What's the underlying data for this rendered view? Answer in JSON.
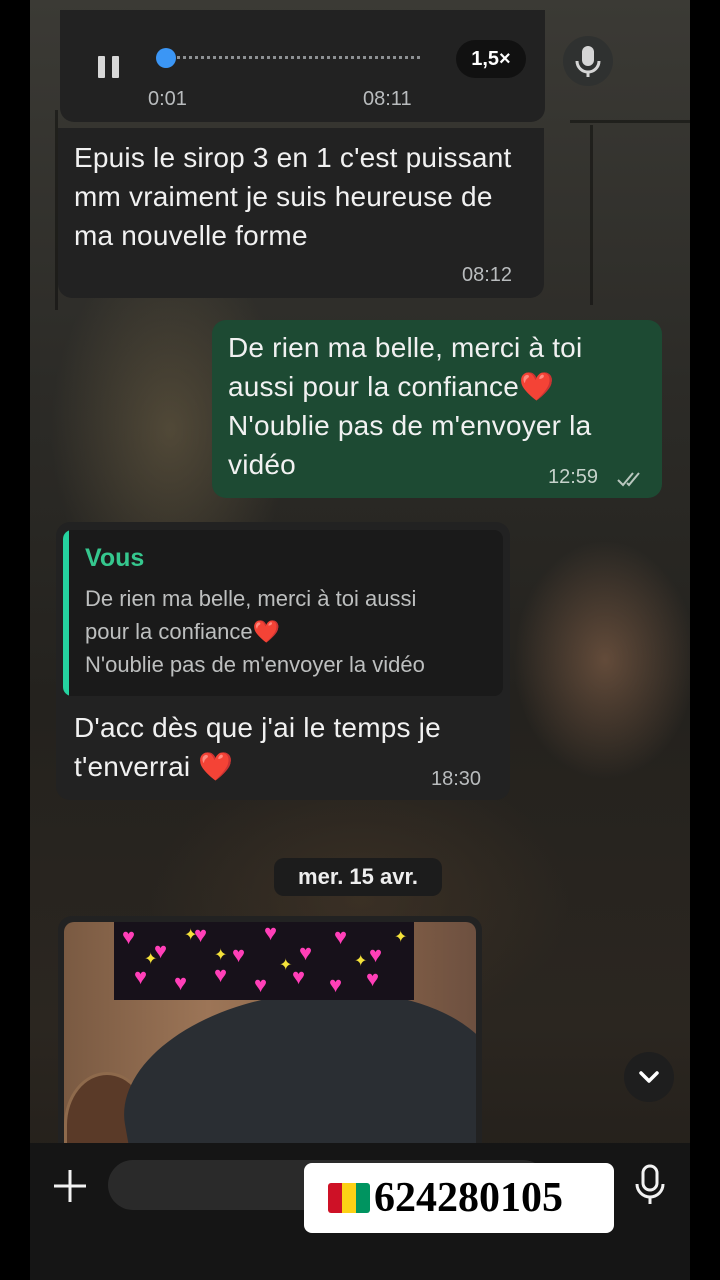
{
  "voice_message": {
    "elapsed": "0:01",
    "time": "08:11",
    "speed": "1,5×",
    "progress": 0.02
  },
  "messages": [
    {
      "text": "Epuis le sirop 3 en 1 c'est puissant mm vraiment je suis heureuse de ma nouvelle forme",
      "time": "08:12"
    },
    {
      "line1": "De rien ma belle, merci à toi",
      "line2": "aussi pour la confiance❤️",
      "line3": "N'oublie pas de m'envoyer la",
      "line4": "vidéo",
      "time": "12:59",
      "status": "read"
    },
    {
      "quote": {
        "author": "Vous",
        "line1": "De rien ma belle, merci à toi aussi",
        "line2": "pour la confiance❤️",
        "line3": "N'oublie pas de m'envoyer la vidéo"
      },
      "line1": "D'acc dès que j'ai le temps je",
      "line2": "t'enverrai ❤️",
      "time": "18:30"
    }
  ],
  "date_separator": "mer. 15 avr.",
  "overlay": {
    "phone": "624280105",
    "flag_colors": [
      "#CE1126",
      "#FCD116",
      "#009460"
    ]
  },
  "colors": {
    "outgoing_bubble": "#1d4a33",
    "incoming_bubble": "#222222",
    "accent": "#25d3a0",
    "progress_dot": "#3b96f5"
  },
  "icons": [
    "pause-icon",
    "microphone-icon",
    "double-check-icon",
    "chevron-down-icon",
    "plus-icon"
  ]
}
